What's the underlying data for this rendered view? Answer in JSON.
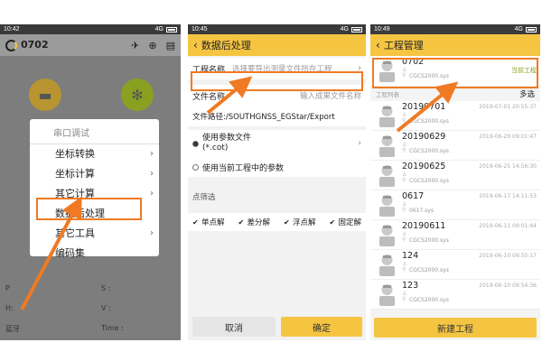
{
  "phone1": {
    "status": {
      "time": "10:42",
      "network": "4G"
    },
    "title": "0702",
    "menu": {
      "header": "串口调试",
      "items": [
        "坐标转换",
        "坐标计算",
        "其它计算",
        "数据后处理",
        "其它工具",
        "编码集"
      ]
    },
    "bottom": {
      "p_label": "P",
      "s_label": "S :",
      "h_label": "H:",
      "v_label": "V :",
      "bt_label": "蓝牙",
      "time_label": "Time :"
    }
  },
  "phone2": {
    "status": {
      "time": "10:45",
      "network": "4G"
    },
    "title": "数据后处理",
    "project_label": "工程名称",
    "project_placeholder": "选择要导出测量文件所在工程",
    "file_label": "文件名称",
    "file_placeholder": "输入成果文件名称",
    "path_text": "文件路径:/SOUTHGNSS_EGStar/Export",
    "radio1_line1": "使用参数文件",
    "radio1_line2": "(*.cot)",
    "radio2": "使用当前工程中的参数",
    "filter_label": "点筛选",
    "checks": [
      "单点解",
      "差分解",
      "浮点解",
      "固定解"
    ],
    "cancel": "取消",
    "ok": "确定"
  },
  "phone3": {
    "status": {
      "time": "10:49",
      "network": "4G"
    },
    "title": "工程管理",
    "current_tag": "当前工程",
    "list_label": "工程列表",
    "multi_select": "多选",
    "projects": [
      {
        "name": "0702",
        "date": "",
        "file": "CGCS2000.sys"
      },
      {
        "name": "20190701",
        "date": "2019-07-01 20:55:37",
        "file": "CGCS2000.sys"
      },
      {
        "name": "20190629",
        "date": "2019-06-29 09:01:47",
        "file": "CGCS2000.sys"
      },
      {
        "name": "20190625",
        "date": "2019-06-25 14:56:30",
        "file": "CGCS2000.sys"
      },
      {
        "name": "0617",
        "date": "2019-06-17 14:11:53",
        "file": "0617.sys"
      },
      {
        "name": "20190611",
        "date": "2019-06-11 09:01:44",
        "file": "CGCS2000.sys"
      },
      {
        "name": "124",
        "date": "2019-06-10 09:55:17",
        "file": "CGCS2000.sys"
      },
      {
        "name": "123",
        "date": "2019-06-10 09:54:36",
        "file": "CGCS2000.sys"
      }
    ],
    "new_project": "新建工程"
  },
  "colors": {
    "accent": "#f5c542",
    "highlight": "#f07a23"
  }
}
